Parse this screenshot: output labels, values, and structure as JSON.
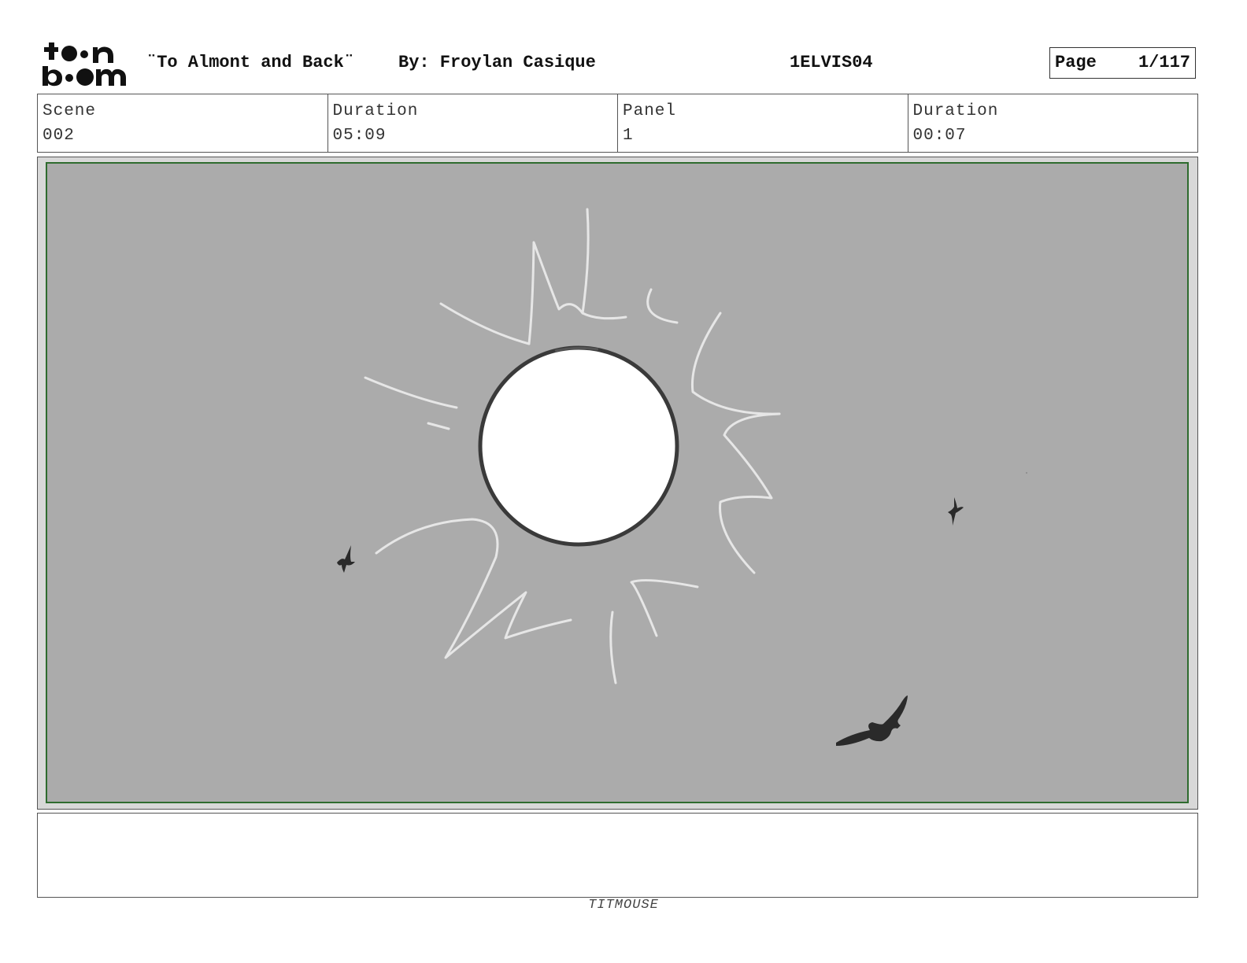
{
  "header": {
    "logo_text": "toon boom",
    "title": "¨To Almont and Back¨",
    "author": "By: Froylan Casique",
    "production_code": "1ELVIS04",
    "page_label": "Page",
    "page_number": "1/117"
  },
  "info": [
    {
      "label": "Scene",
      "value": "002"
    },
    {
      "label": "Duration",
      "value": "05:09"
    },
    {
      "label": "Panel",
      "value": "1"
    },
    {
      "label": "Duration",
      "value": "00:07"
    }
  ],
  "panel": {
    "background_color": "#ababab",
    "frame_color": "#2e6b2e",
    "elements": [
      "sun-sketch",
      "sun-rays-sketch",
      "bird-small-left",
      "bird-small-right",
      "bird-large"
    ]
  },
  "notes": "",
  "footer": "TITMOUSE"
}
